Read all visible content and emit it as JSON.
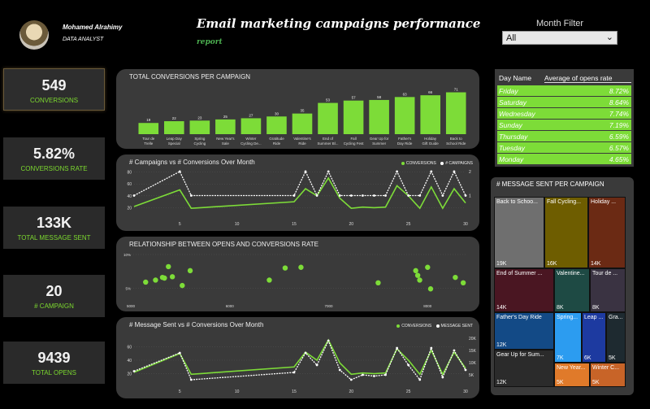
{
  "header": {
    "user_name": "Mohamed Alrahimy",
    "user_role": "DATA ANALYST",
    "title": "Email marketing campaigns performance",
    "subtitle": "report",
    "month_filter_label": "Month Filter",
    "month_filter_value": "All"
  },
  "kpis": [
    {
      "value": "549",
      "label": "CONVERSIONS"
    },
    {
      "value": "5.82%",
      "label": "CONVERSIONS RATE"
    },
    {
      "value": "133K",
      "label": "TOTAL MESSAGE SENT"
    },
    {
      "value": "20",
      "label": "# CAMPAIGN"
    },
    {
      "value": "9439",
      "label": "TOTAL OPENS"
    }
  ],
  "colors": {
    "accent": "#7ddc38",
    "line_white": "#ffffff",
    "panel": "#3a3a3a"
  },
  "chart_data": [
    {
      "type": "bar",
      "title": "TOTAL CONVERSIONS PER CAMPAIGN",
      "categories": [
        "Tour de Trelle",
        "Leap Day Special",
        "Spring Cycling",
        "New Year's Sale",
        "Winter Cycling De...",
        "Gratitude Ride",
        "Valentine's Ride",
        "End of Summer Bl...",
        "Fall Cycling Fest",
        "Gear Up for Summer",
        "Father's Day Ride",
        "Holiday Gift Guide",
        "Back to School Ride"
      ],
      "values": [
        19,
        22,
        23,
        25,
        27,
        30,
        35,
        53,
        57,
        58,
        63,
        66,
        71
      ]
    },
    {
      "type": "line",
      "title": "# Campaigns vs # Conversions Over Month",
      "legend": [
        "CONVERSIONS",
        "# CAMPAIGNS"
      ],
      "x_ticks": [
        "5",
        "10",
        "15",
        "20",
        "25",
        "30"
      ],
      "y_left_ticks": [
        "20",
        "40",
        "60",
        "80"
      ],
      "y_right_ticks": [
        "1",
        "2"
      ],
      "x": [
        1,
        5,
        6,
        15,
        16,
        17,
        18,
        19,
        20,
        21,
        22,
        23,
        24,
        25,
        26,
        27,
        28,
        29,
        30
      ],
      "series": [
        {
          "name": "CONVERSIONS",
          "values": [
            22,
            50,
            19,
            30,
            52,
            40,
            70,
            36,
            19,
            21,
            20,
            21,
            57,
            40,
            19,
            55,
            19,
            52,
            28
          ]
        },
        {
          "name": "# CAMPAIGNS",
          "values": [
            1,
            2,
            1,
            1,
            2,
            1,
            2,
            1,
            1,
            1,
            1,
            1,
            2,
            1,
            1,
            2,
            1,
            2,
            1
          ]
        }
      ]
    },
    {
      "type": "scatter",
      "title": "RELATIONSHIP BETWEEN OPENS AND CONVERSIONS RATE",
      "x_ticks": [
        "5000",
        "6000",
        "7000",
        "8000"
      ],
      "y_ticks": [
        "5%",
        "10%"
      ],
      "points": [
        [
          5150,
          5.9
        ],
        [
          5250,
          6.2
        ],
        [
          5320,
          6.6
        ],
        [
          5340,
          6.5
        ],
        [
          5380,
          8.2
        ],
        [
          5420,
          6.7
        ],
        [
          5520,
          5.4
        ],
        [
          5600,
          7.6
        ],
        [
          6400,
          6.2
        ],
        [
          6560,
          8.0
        ],
        [
          6720,
          8.1
        ],
        [
          7500,
          5.8
        ],
        [
          7880,
          7.6
        ],
        [
          7900,
          6.9
        ],
        [
          7920,
          6.2
        ],
        [
          8000,
          8.1
        ],
        [
          8030,
          4.9
        ],
        [
          8280,
          6.6
        ],
        [
          8360,
          5.8
        ]
      ]
    },
    {
      "type": "line",
      "title": "# Message Sent vs # Conversions Over Month",
      "legend": [
        "CONVERSIONS",
        "MESSAGE SENT"
      ],
      "x_ticks": [
        "5",
        "10",
        "15",
        "20",
        "25",
        "30"
      ],
      "y_left_ticks": [
        "20",
        "40",
        "60"
      ],
      "y_right_ticks": [
        "5K",
        "10K",
        "15K",
        "20K"
      ],
      "x": [
        1,
        5,
        6,
        15,
        16,
        17,
        18,
        19,
        20,
        21,
        22,
        23,
        24,
        25,
        26,
        27,
        28,
        29,
        30
      ],
      "series": [
        {
          "name": "CONVERSIONS",
          "values": [
            22,
            50,
            19,
            30,
            52,
            40,
            70,
            36,
            19,
            21,
            20,
            21,
            57,
            40,
            19,
            55,
            19,
            52,
            28
          ]
        },
        {
          "name": "MESSAGE SENT",
          "values": [
            6500,
            14000,
            3000,
            6000,
            14000,
            9000,
            19000,
            7000,
            3000,
            5000,
            4500,
            5000,
            16000,
            9000,
            3000,
            16000,
            4000,
            15000,
            7000
          ]
        }
      ]
    },
    {
      "type": "table",
      "title": "Day Name / Average of opens rate",
      "columns": [
        "Day Name",
        "Average of opens rate"
      ],
      "rows": [
        [
          "Friday",
          "8.72%"
        ],
        [
          "Saturday",
          "8.64%"
        ],
        [
          "Wednesday",
          "7.74%"
        ],
        [
          "Sunday",
          "7.19%"
        ],
        [
          "Thursday",
          "6.59%"
        ],
        [
          "Tuesday",
          "6.57%"
        ],
        [
          "Monday",
          "4.65%"
        ]
      ]
    },
    {
      "type": "heatmap",
      "title": "# MESSAGE SENT PER CAMPAIGN",
      "cells": [
        {
          "name": "Back to Schoo...",
          "value": "19K",
          "color": "#6f6f6f"
        },
        {
          "name": "Fall Cycling...",
          "value": "16K",
          "color": "#6e5d00"
        },
        {
          "name": "Holiday ...",
          "value": "14K",
          "color": "#6b2a14"
        },
        {
          "name": "End of Summer ...",
          "value": "14K",
          "color": "#4a1622"
        },
        {
          "name": "Valentine...",
          "value": "8K",
          "color": "#1e4a44"
        },
        {
          "name": "Tour de ...",
          "value": "8K",
          "color": "#3a3342"
        },
        {
          "name": "Father's Day Ride",
          "value": "12K",
          "color": "#134a86"
        },
        {
          "name": "Spring...",
          "value": "7K",
          "color": "#2c9cf0"
        },
        {
          "name": "Leap ...",
          "value": "6K",
          "color": "#1d3aa0"
        },
        {
          "name": "Gra...",
          "value": "5K",
          "color": "#1e2a30"
        },
        {
          "name": "Gear Up for Sum...",
          "value": "12K",
          "color": "#2b2b2b"
        },
        {
          "name": "New Year...",
          "value": "5K",
          "color": "#e07a2a"
        },
        {
          "name": "Winter C...",
          "value": "5K",
          "color": "#c86428"
        }
      ]
    }
  ]
}
